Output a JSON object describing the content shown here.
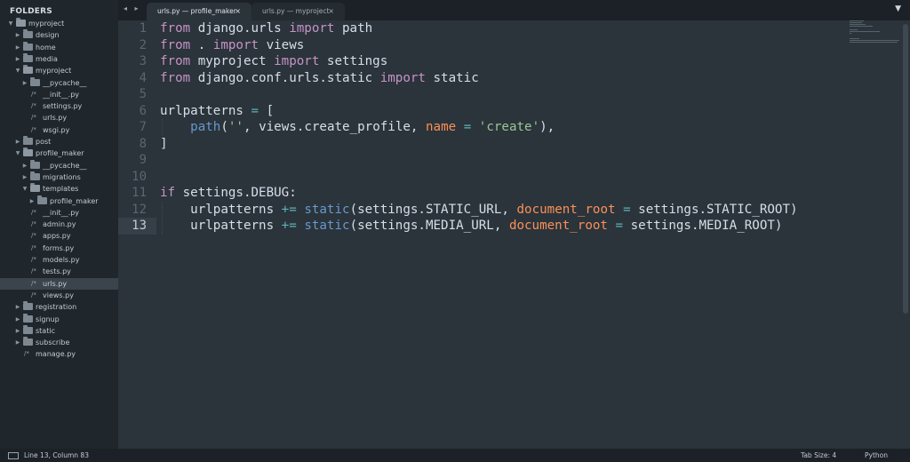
{
  "sidebar": {
    "title": "FOLDERS",
    "items": [
      {
        "label": "myproject",
        "type": "folder",
        "open": true,
        "depth": 0
      },
      {
        "label": "design",
        "type": "folder",
        "open": false,
        "depth": 1
      },
      {
        "label": "home",
        "type": "folder",
        "open": false,
        "depth": 1
      },
      {
        "label": "media",
        "type": "folder",
        "open": false,
        "depth": 1
      },
      {
        "label": "myproject",
        "type": "folder",
        "open": true,
        "depth": 1
      },
      {
        "label": "__pycache__",
        "type": "folder",
        "open": false,
        "depth": 2
      },
      {
        "label": "__init__.py",
        "type": "file",
        "depth": 2
      },
      {
        "label": "settings.py",
        "type": "file",
        "depth": 2
      },
      {
        "label": "urls.py",
        "type": "file",
        "depth": 2
      },
      {
        "label": "wsgi.py",
        "type": "file",
        "depth": 2
      },
      {
        "label": "post",
        "type": "folder",
        "open": false,
        "depth": 1
      },
      {
        "label": "profile_maker",
        "type": "folder",
        "open": true,
        "depth": 1
      },
      {
        "label": "__pycache__",
        "type": "folder",
        "open": false,
        "depth": 2
      },
      {
        "label": "migrations",
        "type": "folder",
        "open": false,
        "depth": 2
      },
      {
        "label": "templates",
        "type": "folder",
        "open": true,
        "depth": 2
      },
      {
        "label": "profile_maker",
        "type": "folder",
        "open": false,
        "depth": 3
      },
      {
        "label": "__init__.py",
        "type": "file",
        "depth": 2
      },
      {
        "label": "admin.py",
        "type": "file",
        "depth": 2
      },
      {
        "label": "apps.py",
        "type": "file",
        "depth": 2
      },
      {
        "label": "forms.py",
        "type": "file",
        "depth": 2
      },
      {
        "label": "models.py",
        "type": "file",
        "depth": 2
      },
      {
        "label": "tests.py",
        "type": "file",
        "depth": 2
      },
      {
        "label": "urls.py",
        "type": "file",
        "depth": 2,
        "selected": true
      },
      {
        "label": "views.py",
        "type": "file",
        "depth": 2
      },
      {
        "label": "registration",
        "type": "folder",
        "open": false,
        "depth": 1
      },
      {
        "label": "signup",
        "type": "folder",
        "open": false,
        "depth": 1
      },
      {
        "label": "static",
        "type": "folder",
        "open": false,
        "depth": 1
      },
      {
        "label": "subscribe",
        "type": "folder",
        "open": false,
        "depth": 1
      },
      {
        "label": "manage.py",
        "type": "file",
        "depth": 1
      }
    ]
  },
  "tabs": {
    "nav_arrows": "◂ ▸",
    "menu_icon": "▼",
    "close_glyph": "×",
    "items": [
      {
        "label": "urls.py — profile_maker",
        "active": true
      },
      {
        "label": "urls.py — myproject",
        "active": false
      }
    ]
  },
  "editor": {
    "current_line": 13,
    "lines": [
      {
        "n": "1",
        "tokens": [
          [
            "kw",
            "from"
          ],
          [
            "pu",
            " django.urls "
          ],
          [
            "kw",
            "import"
          ],
          [
            "pu",
            " path"
          ]
        ]
      },
      {
        "n": "2",
        "tokens": [
          [
            "kw",
            "from"
          ],
          [
            "pu",
            " . "
          ],
          [
            "kw",
            "import"
          ],
          [
            "pu",
            " views"
          ]
        ]
      },
      {
        "n": "3",
        "tokens": [
          [
            "kw",
            "from"
          ],
          [
            "pu",
            " myproject "
          ],
          [
            "kw",
            "import"
          ],
          [
            "pu",
            " settings"
          ]
        ]
      },
      {
        "n": "4",
        "tokens": [
          [
            "kw",
            "from"
          ],
          [
            "pu",
            " django.conf.urls.static "
          ],
          [
            "kw",
            "import"
          ],
          [
            "pu",
            " static"
          ]
        ]
      },
      {
        "n": "5",
        "tokens": []
      },
      {
        "n": "6",
        "tokens": [
          [
            "pu",
            "urlpatterns "
          ],
          [
            "op",
            "="
          ],
          [
            "pu",
            " ["
          ]
        ]
      },
      {
        "n": "7",
        "tokens": [
          [
            "pu",
            "    "
          ],
          [
            "fn",
            "path"
          ],
          [
            "pu",
            "("
          ],
          [
            "st",
            "''"
          ],
          [
            "pu",
            ", views.create_profile, "
          ],
          [
            "pm",
            "name"
          ],
          [
            "pu",
            " "
          ],
          [
            "op",
            "="
          ],
          [
            "pu",
            " "
          ],
          [
            "st",
            "'create'"
          ],
          [
            "pu",
            "),"
          ]
        ]
      },
      {
        "n": "8",
        "tokens": [
          [
            "pu",
            "]"
          ]
        ]
      },
      {
        "n": "9",
        "tokens": []
      },
      {
        "n": "10",
        "tokens": []
      },
      {
        "n": "11",
        "tokens": [
          [
            "kw",
            "if"
          ],
          [
            "pu",
            " settings.DEBUG:"
          ]
        ]
      },
      {
        "n": "12",
        "tokens": [
          [
            "pu",
            "    urlpatterns "
          ],
          [
            "op",
            "+="
          ],
          [
            "pu",
            " "
          ],
          [
            "fn",
            "static"
          ],
          [
            "pu",
            "(settings.STATIC_URL, "
          ],
          [
            "pm",
            "document_root"
          ],
          [
            "pu",
            " "
          ],
          [
            "op",
            "="
          ],
          [
            "pu",
            " settings.STATIC_ROOT)"
          ]
        ]
      },
      {
        "n": "13",
        "tokens": [
          [
            "pu",
            "    urlpatterns "
          ],
          [
            "op",
            "+="
          ],
          [
            "pu",
            " "
          ],
          [
            "fn",
            "static"
          ],
          [
            "pu",
            "(settings.MEDIA_URL, "
          ],
          [
            "pm",
            "document_root"
          ],
          [
            "pu",
            " "
          ],
          [
            "op",
            "="
          ],
          [
            "pu",
            " settings.MEDIA_ROOT)"
          ]
        ]
      }
    ]
  },
  "statusbar": {
    "position": "Line 13, Column 83",
    "tab_size": "Tab Size: 4",
    "language": "Python"
  }
}
